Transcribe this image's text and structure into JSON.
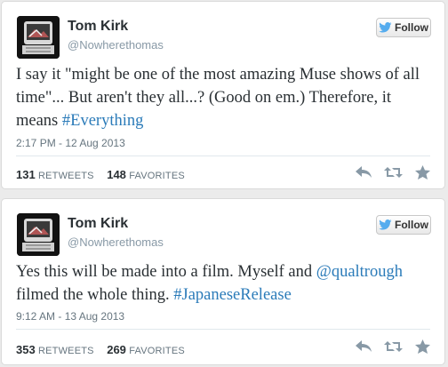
{
  "tweets": [
    {
      "name": "Tom Kirk",
      "handle": "@Nowherethomas",
      "follow_label": "Follow",
      "text_parts": [
        {
          "text": "I say it \"might be one of the most amazing Muse shows of all time\"... But aren't they all...? (Good on em.) Therefore, it means ",
          "link": false
        },
        {
          "text": "#Everything",
          "link": true
        }
      ],
      "timestamp": "2:17 PM - 12 Aug 2013",
      "retweets": "131",
      "retweets_label": "RETWEETS",
      "favorites": "148",
      "favorites_label": "FAVORITES"
    },
    {
      "name": "Tom Kirk",
      "handle": "@Nowherethomas",
      "follow_label": "Follow",
      "text_parts": [
        {
          "text": "Yes this will be made into a film. Myself and ",
          "link": false
        },
        {
          "text": "@qualtrough",
          "link": true
        },
        {
          "text": " filmed the whole thing. ",
          "link": false
        },
        {
          "text": "#JapaneseRelease",
          "link": true
        }
      ],
      "timestamp": "9:12 AM - 13 Aug 2013",
      "retweets": "353",
      "retweets_label": "RETWEETS",
      "favorites": "269",
      "favorites_label": "FAVORITES"
    }
  ],
  "icons": {
    "follow": "twitter-bird-icon",
    "reply": "reply-icon",
    "retweet": "retweet-icon",
    "favorite": "star-icon"
  },
  "colors": {
    "link": "#2b7bb9",
    "bird": "#55acee",
    "action_icon": "#8899a6"
  }
}
